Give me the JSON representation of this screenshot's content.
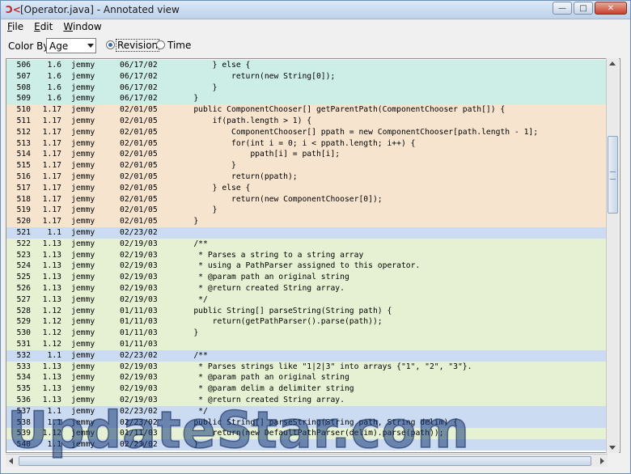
{
  "window": {
    "title": "[Operator.java] - Annotated view",
    "buttons": {
      "minimize": "—",
      "maximize": "□",
      "close": "✕"
    }
  },
  "menu": [
    {
      "label": "File",
      "mnemonic": "F",
      "rest": "ile"
    },
    {
      "label": "Edit",
      "mnemonic": "E",
      "rest": "dit"
    },
    {
      "label": "Window",
      "mnemonic": "W",
      "rest": "indow"
    }
  ],
  "toolbar": {
    "color_by_label": "Color By:",
    "color_by_value": "Age",
    "radio_revision": "Revision",
    "radio_time": "Time",
    "selected": "Revision"
  },
  "colors": {
    "rev_1_6": "#cdeee6",
    "rev_1_17": "#f6e4cf",
    "rev_1_13": "#e6f1d3",
    "rev_1_12": "#e6f1d3",
    "rev_1_1": "#cbdcf2"
  },
  "lines": [
    {
      "line": "506",
      "rev": "1.6",
      "author": "jemmy",
      "date": "06/17/02",
      "code": "        } else {",
      "color": "#cdeee6"
    },
    {
      "line": "507",
      "rev": "1.6",
      "author": "jemmy",
      "date": "06/17/02",
      "code": "            return(new String[0]);",
      "color": "#cdeee6"
    },
    {
      "line": "508",
      "rev": "1.6",
      "author": "jemmy",
      "date": "06/17/02",
      "code": "        }",
      "color": "#cdeee6"
    },
    {
      "line": "509",
      "rev": "1.6",
      "author": "jemmy",
      "date": "06/17/02",
      "code": "    }",
      "color": "#cdeee6"
    },
    {
      "line": "510",
      "rev": "1.17",
      "author": "jemmy",
      "date": "02/01/05",
      "code": "    public ComponentChooser[] getParentPath(ComponentChooser path[]) {",
      "color": "#f6e4cf"
    },
    {
      "line": "511",
      "rev": "1.17",
      "author": "jemmy",
      "date": "02/01/05",
      "code": "        if(path.length > 1) {",
      "color": "#f6e4cf"
    },
    {
      "line": "512",
      "rev": "1.17",
      "author": "jemmy",
      "date": "02/01/05",
      "code": "            ComponentChooser[] ppath = new ComponentChooser[path.length - 1];",
      "color": "#f6e4cf"
    },
    {
      "line": "513",
      "rev": "1.17",
      "author": "jemmy",
      "date": "02/01/05",
      "code": "            for(int i = 0; i < ppath.length; i++) {",
      "color": "#f6e4cf"
    },
    {
      "line": "514",
      "rev": "1.17",
      "author": "jemmy",
      "date": "02/01/05",
      "code": "                ppath[i] = path[i];",
      "color": "#f6e4cf"
    },
    {
      "line": "515",
      "rev": "1.17",
      "author": "jemmy",
      "date": "02/01/05",
      "code": "            }",
      "color": "#f6e4cf"
    },
    {
      "line": "516",
      "rev": "1.17",
      "author": "jemmy",
      "date": "02/01/05",
      "code": "            return(ppath);",
      "color": "#f6e4cf"
    },
    {
      "line": "517",
      "rev": "1.17",
      "author": "jemmy",
      "date": "02/01/05",
      "code": "        } else {",
      "color": "#f6e4cf"
    },
    {
      "line": "518",
      "rev": "1.17",
      "author": "jemmy",
      "date": "02/01/05",
      "code": "            return(new ComponentChooser[0]);",
      "color": "#f6e4cf"
    },
    {
      "line": "519",
      "rev": "1.17",
      "author": "jemmy",
      "date": "02/01/05",
      "code": "        }",
      "color": "#f6e4cf"
    },
    {
      "line": "520",
      "rev": "1.17",
      "author": "jemmy",
      "date": "02/01/05",
      "code": "    }",
      "color": "#f6e4cf"
    },
    {
      "line": "521",
      "rev": "1.1",
      "author": "jemmy",
      "date": "02/23/02",
      "code": "",
      "color": "#cbdcf2"
    },
    {
      "line": "522",
      "rev": "1.13",
      "author": "jemmy",
      "date": "02/19/03",
      "code": "    /**",
      "color": "#e6f1d3"
    },
    {
      "line": "523",
      "rev": "1.13",
      "author": "jemmy",
      "date": "02/19/03",
      "code": "     * Parses a string to a string array",
      "color": "#e6f1d3"
    },
    {
      "line": "524",
      "rev": "1.13",
      "author": "jemmy",
      "date": "02/19/03",
      "code": "     * using a PathParser assigned to this operator.",
      "color": "#e6f1d3"
    },
    {
      "line": "525",
      "rev": "1.13",
      "author": "jemmy",
      "date": "02/19/03",
      "code": "     * @param path an original string",
      "color": "#e6f1d3"
    },
    {
      "line": "526",
      "rev": "1.13",
      "author": "jemmy",
      "date": "02/19/03",
      "code": "     * @return created String array.",
      "color": "#e6f1d3"
    },
    {
      "line": "527",
      "rev": "1.13",
      "author": "jemmy",
      "date": "02/19/03",
      "code": "     */",
      "color": "#e6f1d3"
    },
    {
      "line": "528",
      "rev": "1.12",
      "author": "jemmy",
      "date": "01/11/03",
      "code": "    public String[] parseString(String path) {",
      "color": "#e6f1d3"
    },
    {
      "line": "529",
      "rev": "1.12",
      "author": "jemmy",
      "date": "01/11/03",
      "code": "        return(getPathParser().parse(path));",
      "color": "#e6f1d3"
    },
    {
      "line": "530",
      "rev": "1.12",
      "author": "jemmy",
      "date": "01/11/03",
      "code": "    }",
      "color": "#e6f1d3"
    },
    {
      "line": "531",
      "rev": "1.12",
      "author": "jemmy",
      "date": "01/11/03",
      "code": "",
      "color": "#e6f1d3"
    },
    {
      "line": "532",
      "rev": "1.1",
      "author": "jemmy",
      "date": "02/23/02",
      "code": "    /**",
      "color": "#cbdcf2"
    },
    {
      "line": "533",
      "rev": "1.13",
      "author": "jemmy",
      "date": "02/19/03",
      "code": "     * Parses strings like \"1|2|3\" into arrays {\"1\", \"2\", \"3\"}.",
      "color": "#e6f1d3"
    },
    {
      "line": "534",
      "rev": "1.13",
      "author": "jemmy",
      "date": "02/19/03",
      "code": "     * @param path an original string",
      "color": "#e6f1d3"
    },
    {
      "line": "535",
      "rev": "1.13",
      "author": "jemmy",
      "date": "02/19/03",
      "code": "     * @param delim a delimiter string",
      "color": "#e6f1d3"
    },
    {
      "line": "536",
      "rev": "1.13",
      "author": "jemmy",
      "date": "02/19/03",
      "code": "     * @return created String array.",
      "color": "#e6f1d3"
    },
    {
      "line": "537",
      "rev": "1.1",
      "author": "jemmy",
      "date": "02/23/02",
      "code": "     */",
      "color": "#cbdcf2"
    },
    {
      "line": "538",
      "rev": "1.1",
      "author": "jemmy",
      "date": "02/23/02",
      "code": "    public String[] parseString(String path, String delim) {",
      "color": "#cbdcf2"
    },
    {
      "line": "539",
      "rev": "1.12",
      "author": "jemmy",
      "date": "01/11/03",
      "code": "        return(new DefaultPathParser(delim).parse(path));",
      "color": "#e6f1d3"
    },
    {
      "line": "540",
      "rev": "1.1",
      "author": "jemmy",
      "date": "02/23/02",
      "code": "    }",
      "color": "#cbdcf2"
    }
  ],
  "watermark": "UpdateStar.com"
}
